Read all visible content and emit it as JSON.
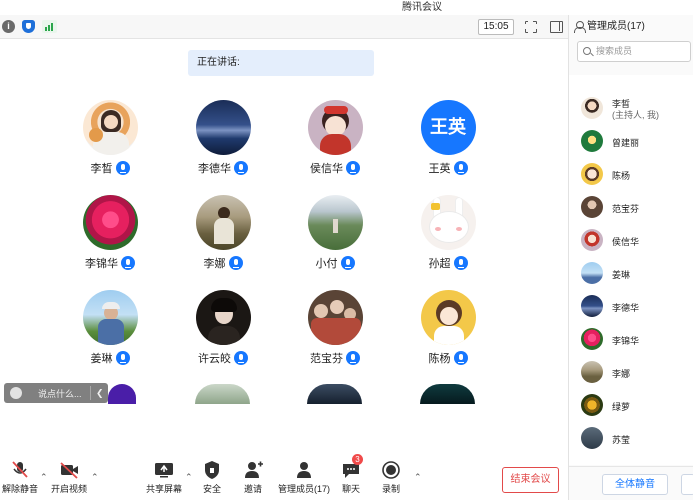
{
  "window": {
    "title": "腾讯会议"
  },
  "toolbar": {
    "time": "15:05"
  },
  "speaking": {
    "label": "正在讲话:"
  },
  "participants": [
    {
      "name": "李晳"
    },
    {
      "name": "李德华"
    },
    {
      "name": "侯信华"
    },
    {
      "name": "王英",
      "avatar_text": "王英"
    },
    {
      "name": "李锦华"
    },
    {
      "name": "李娜"
    },
    {
      "name": "小付"
    },
    {
      "name": "孙超"
    },
    {
      "name": "姜琳"
    },
    {
      "name": "许云皎"
    },
    {
      "name": "范宝芬"
    },
    {
      "name": "陈杨"
    }
  ],
  "chat": {
    "placeholder": "说点什么..."
  },
  "bottom_toolbar": {
    "unmute": "解除静音",
    "video": "开启视频",
    "share": "共享屏幕",
    "security": "安全",
    "invite": "邀请",
    "manage": "管理成员(17)",
    "chat": "聊天",
    "chat_badge": "3",
    "record": "录制",
    "end": "结束会议"
  },
  "members_panel": {
    "title": "管理成员(17)",
    "search_placeholder": "搜索成员",
    "members": [
      {
        "name": "李晳",
        "sub": "(主持人, 我)"
      },
      {
        "name": "曾建丽"
      },
      {
        "name": "陈杨"
      },
      {
        "name": "范宝芬"
      },
      {
        "name": "侯信华"
      },
      {
        "name": "姜琳"
      },
      {
        "name": "李德华"
      },
      {
        "name": "李锦华"
      },
      {
        "name": "李娜"
      },
      {
        "name": "绿萝"
      },
      {
        "name": "苏莹"
      }
    ],
    "mute_all": "全体静音"
  },
  "colors": {
    "accent": "#1677ff",
    "danger": "#e24a4a",
    "speaking_bg": "#e4eefc"
  }
}
